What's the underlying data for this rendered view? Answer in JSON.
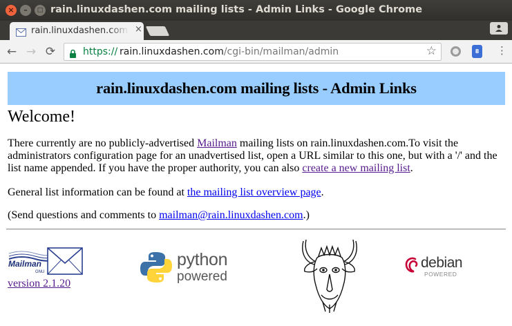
{
  "window": {
    "title": "rain.linuxdashen.com mailing lists - Admin Links - Google Chrome",
    "buttons": {
      "close": "×",
      "minimize": "–",
      "maximize": "□"
    }
  },
  "tabs": [
    {
      "title": "rain.linuxdashen.com mailing lists - Admin Links",
      "close": "×",
      "icon": "envelope-icon"
    }
  ],
  "profile_icon": "person-icon",
  "toolbar": {
    "back": "←",
    "forward": "→",
    "reload": "⟳",
    "url_scheme": "https://",
    "url_host": "rain.linuxdashen.com",
    "url_path": "/cgi-bin/mailman/admin",
    "bookmark": "☆",
    "menu": "⋮",
    "extension_badge": "8"
  },
  "page": {
    "banner_title": "rain.linuxdashen.com mailing lists - Admin Links",
    "welcome": "Welcome!",
    "p1_text_1": "There currently are no publicly-advertised ",
    "p1_link_mailman": "Mailman",
    "p1_text_2": " mailing lists on rain.linuxdashen.com.To visit the administrators configuration page for an unadvertised list, open a URL similar to this one, but with a '/' and the list name appended. If you have the proper authority, you can also ",
    "p1_link_create": "create a new mailing list",
    "p1_text_3": ".",
    "p2_text_1": "General list information can be found at ",
    "p2_link": "the mailing list overview page",
    "p2_text_2": ".",
    "p3_text_1": "(Send questions and comments to ",
    "p3_link": "mailman@rain.linuxdashen.com",
    "p3_text_2": ".)",
    "mailman_version": "version 2.1.20",
    "mailman_logo_text": "Mailman",
    "mailman_logo_gnu": "GNU",
    "python_word": "python",
    "python_sub": "powered",
    "debian_word": "debian",
    "debian_sub": "POWERED"
  },
  "colors": {
    "banner_bg": "#99ccff",
    "visited_link": "#551a8b",
    "link": "#0000ee",
    "secure_green": "#0b8043"
  }
}
